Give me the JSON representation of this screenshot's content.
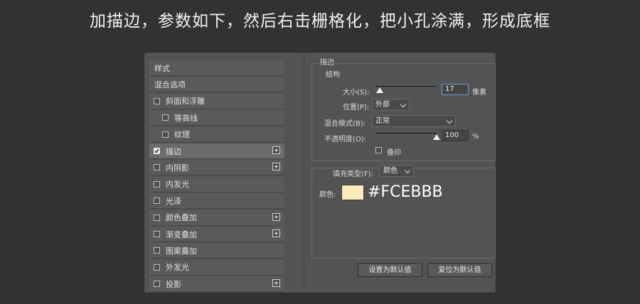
{
  "caption": "加描边，参数如下，然后右击栅格化，把小孔涂满，形成底框",
  "style_list": [
    {
      "label": "样式",
      "type": "header"
    },
    {
      "label": "混合选项",
      "type": "header"
    },
    {
      "label": "斜面和浮雕",
      "checked": false,
      "plus": false
    },
    {
      "label": "等高线",
      "checked": false,
      "plus": false,
      "indent": true
    },
    {
      "label": "纹理",
      "checked": false,
      "plus": false,
      "indent": true
    },
    {
      "label": "描边",
      "checked": true,
      "plus": true,
      "selected": true
    },
    {
      "label": "内阴影",
      "checked": false,
      "plus": true
    },
    {
      "label": "内发光",
      "checked": false,
      "plus": false
    },
    {
      "label": "光泽",
      "checked": false,
      "plus": false
    },
    {
      "label": "颜色叠加",
      "checked": false,
      "plus": true
    },
    {
      "label": "渐变叠加",
      "checked": false,
      "plus": true
    },
    {
      "label": "图案叠加",
      "checked": false,
      "plus": false
    },
    {
      "label": "外发光",
      "checked": false,
      "plus": false
    },
    {
      "label": "投影",
      "checked": false,
      "plus": true
    }
  ],
  "stroke": {
    "panel_title": "描边",
    "structure_title": "结构",
    "size_label": "大小(S):",
    "size_value": "17",
    "size_unit": "像素",
    "size_fraction": 0.07,
    "position_label": "位置(P):",
    "position_value": "外部",
    "blend_label": "混合模式(B):",
    "blend_value": "正常",
    "opacity_label": "不透明度(O):",
    "opacity_value": "100",
    "opacity_unit": "%",
    "opacity_fraction": 1.0,
    "overprint_label": "叠印",
    "overprint_checked": false,
    "fill_type_label": "填充类型(F):",
    "fill_type_value": "颜色",
    "color_label": "颜色:",
    "color_hex": "#FCEBBB"
  },
  "buttons": {
    "set_default": "设置为默认值",
    "reset_default": "复位为默认值"
  }
}
